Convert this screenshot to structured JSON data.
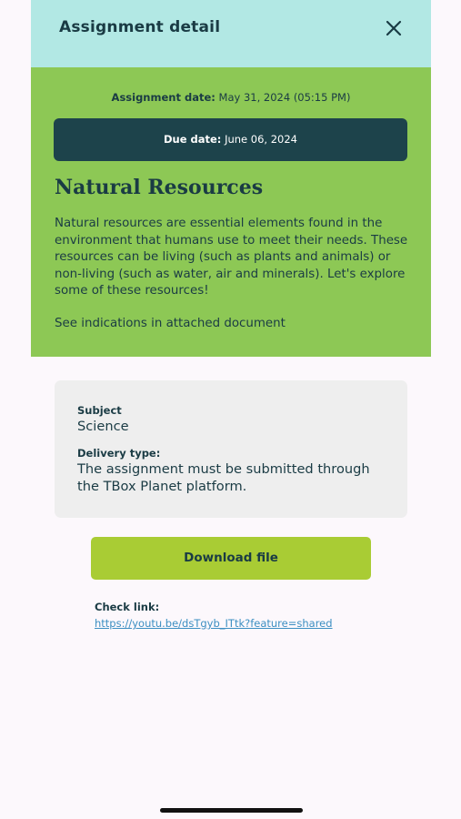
{
  "header": {
    "title": "Assignment detail",
    "close_icon": "close-icon"
  },
  "assignment": {
    "assignment_date_label": "Assignment date:",
    "assignment_date_value": "May 31, 2024 (05:15 PM)",
    "due_date_label": "Due date:",
    "due_date_value": "June 06, 2024",
    "title": "Natural Resources",
    "description": "Natural resources are essential elements found in the environment that humans use to meet their needs. These resources can be living (such as plants and animals) or non-living (such as water, air and minerals). Let's explore some of these resources!",
    "indications": "See indications in attached document"
  },
  "info": {
    "subject_label": "Subject",
    "subject_value": "Science",
    "delivery_label": "Delivery type:",
    "delivery_value": "The assignment must be submitted through the TBox Planet platform."
  },
  "actions": {
    "download_label": "Download file",
    "check_link_label": "Check link:",
    "check_link_url": "https://youtu.be/dsTgyb_ITtk?feature=shared"
  },
  "colors": {
    "header_bg": "#b2e8e4",
    "panel_bg": "#8dc855",
    "due_bg": "#1d434b",
    "button_bg": "#a9cc34",
    "text": "#1a3b44",
    "link": "#3c8fc2"
  }
}
